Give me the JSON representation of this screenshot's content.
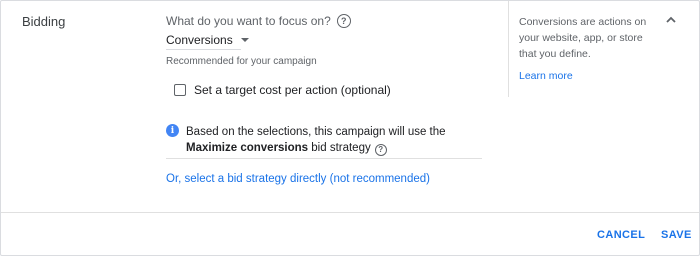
{
  "section": {
    "title": "Bidding"
  },
  "focus": {
    "label": "What do you want to focus on?",
    "selected": "Conversions",
    "helper": "Recommended for your campaign"
  },
  "target_cpa": {
    "label": "Set a target cost per action (optional)",
    "checked": false
  },
  "info": {
    "icon_text": "i",
    "text_before": "Based on the selections, this campaign will use the ",
    "strategy_name": "Maximize conversions",
    "text_after": " bid strategy"
  },
  "bid_strategy_link": "Or, select a bid strategy directly (not recommended)",
  "side_panel": {
    "description": "Conversions are actions on your website, app, or store that you define.",
    "learn_more": "Learn more"
  },
  "footer": {
    "cancel_label": "CANCEL",
    "save_label": "SAVE"
  },
  "colors": {
    "accent": "#1a73e8",
    "info_icon": "#4285f4",
    "text": "#202124",
    "muted": "#5f6368"
  },
  "icons": {
    "help": "help-icon",
    "info": "info-icon",
    "collapse": "chevron-up-icon",
    "dropdown": "caret-down-icon"
  }
}
